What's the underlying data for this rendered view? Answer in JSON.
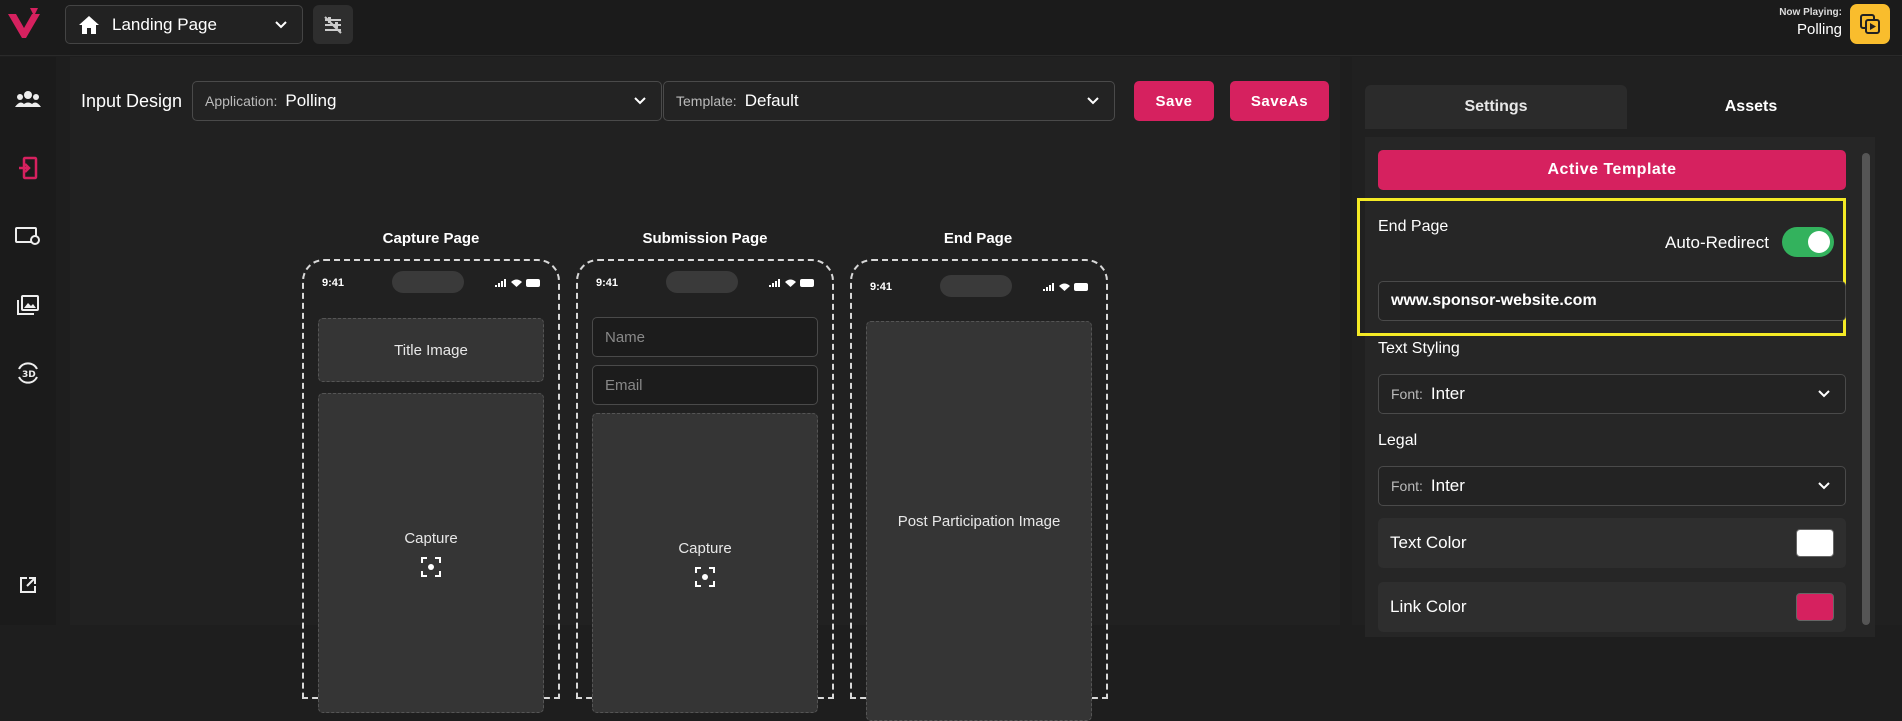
{
  "header": {
    "page_select": "Landing Page",
    "now_playing_label": "Now Playing:",
    "now_playing_value": "Polling"
  },
  "main": {
    "title": "Input Design",
    "application": {
      "prefix": "Application:",
      "value": "Polling"
    },
    "template": {
      "prefix": "Template:",
      "value": "Default"
    },
    "save_label": "Save",
    "saveas_label": "SaveAs",
    "phones": [
      {
        "title": "Capture Page",
        "time": "9:41",
        "title_image": "Title Image",
        "capture": "Capture"
      },
      {
        "title": "Submission Page",
        "time": "9:41",
        "name_placeholder": "Name",
        "email_placeholder": "Email",
        "capture": "Capture"
      },
      {
        "title": "End Page",
        "time": "9:41",
        "post": "Post Participation Image"
      }
    ]
  },
  "panel": {
    "tabs": [
      "Settings",
      "Assets"
    ],
    "active_template": "Active Template",
    "end_page_label": "End Page",
    "auto_redirect_label": "Auto-Redirect",
    "auto_redirect_on": true,
    "redirect_url": "www.sponsor-website.com",
    "text_styling_label": "Text Styling",
    "text_styling_font": {
      "prefix": "Font:",
      "value": "Inter"
    },
    "legal_label": "Legal",
    "legal_font": {
      "prefix": "Font:",
      "value": "Inter"
    },
    "text_color_label": "Text Color",
    "text_color": "#ffffff",
    "link_color_label": "Link Color",
    "link_color": "#d6215f"
  },
  "colors": {
    "accent": "#d6215f",
    "toggle_on": "#33b25d",
    "now_playing": "#f9bd2d",
    "highlight": "#f4ea25"
  }
}
